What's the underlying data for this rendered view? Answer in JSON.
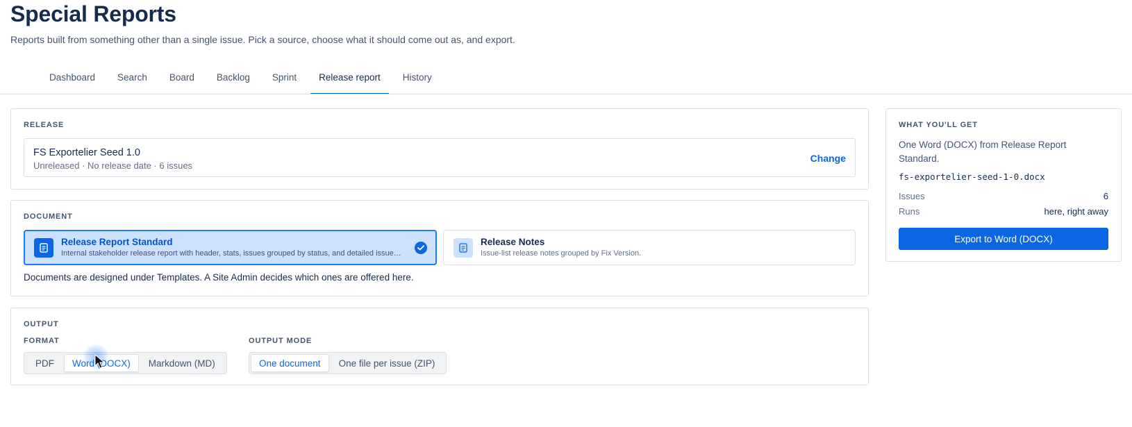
{
  "page": {
    "title": "Special Reports",
    "subtitle": "Reports built from something other than a single issue. Pick a source, choose what it should come out as, and export."
  },
  "tabs": [
    {
      "label": "Dashboard"
    },
    {
      "label": "Search"
    },
    {
      "label": "Board"
    },
    {
      "label": "Backlog"
    },
    {
      "label": "Sprint"
    },
    {
      "label": "Release report",
      "active": true
    },
    {
      "label": "History"
    }
  ],
  "release": {
    "section_label": "RELEASE",
    "name": "FS Exportelier Seed 1.0",
    "meta": "Unreleased · No release date · 6 issues",
    "change_label": "Change"
  },
  "document": {
    "section_label": "DOCUMENT",
    "options": [
      {
        "title": "Release Report Standard",
        "description": "Internal stakeholder release report with header, stats, issues grouped by status, and detailed issue …",
        "selected": true,
        "icon": "document-icon"
      },
      {
        "title": "Release Notes",
        "description": "Issue-list release notes grouped by Fix Version.",
        "selected": false,
        "icon": "document-icon"
      }
    ],
    "note": "Documents are designed under Templates. A Site Admin decides which ones are offered here."
  },
  "output": {
    "section_label": "OUTPUT",
    "format_label": "FORMAT",
    "formats": [
      {
        "label": "PDF",
        "active": false
      },
      {
        "label": "Word (DOCX)",
        "active": true
      },
      {
        "label": "Markdown (MD)",
        "active": false
      }
    ],
    "mode_label": "OUTPUT MODE",
    "modes": [
      {
        "label": "One document",
        "active": true
      },
      {
        "label": "One file per issue (ZIP)",
        "active": false
      }
    ]
  },
  "summary": {
    "section_label": "WHAT YOU'LL GET",
    "text": "One Word (DOCX) from Release Report Standard.",
    "filename": "fs-exportelier-seed-1-0.docx",
    "issues_label": "Issues",
    "issues_value": "6",
    "runs_label": "Runs",
    "runs_value": "here, right away",
    "export_label": "Export to Word (DOCX)"
  },
  "colors": {
    "accent": "#0c66e4",
    "selected_bg": "#cce0ff",
    "text": "#172b4d",
    "subtle_text": "#626f86",
    "border": "#dcdfe4"
  }
}
